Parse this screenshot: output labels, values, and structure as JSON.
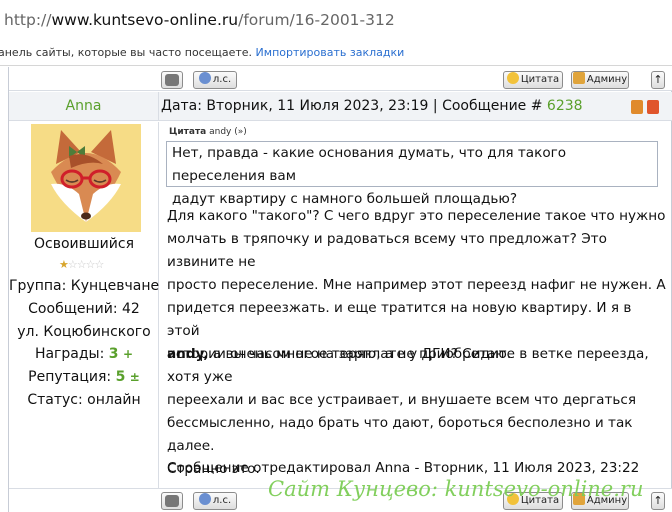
{
  "browser": {
    "url_prefix": "http://",
    "url_host": "www.kuntsevo-online.ru",
    "url_path": "/forum/16-2001-312"
  },
  "bookmarks_bar": {
    "text": "анель сайты, которые вы часто посещаете.",
    "import_link": "Импортировать закладки"
  },
  "toolbar": {
    "pm_label": "л.с.",
    "quote_label": "Цитата",
    "admin_label": "Админу",
    "up_label": "↑"
  },
  "post": {
    "author": "Anna",
    "date_text": "Дата: Вторник, 11 Июля 2023, 23:19 | Сообщение #",
    "number": "6238"
  },
  "profile": {
    "rank": "Освоившийся",
    "stars": "★",
    "stars_empty": "☆☆☆☆",
    "group": "Группа: Кунцевчане",
    "messages": "Сообщений: 42",
    "street": "ул. Коцюбинского",
    "awards_label": "Награды:",
    "awards_value": "3",
    "awards_plus": "+",
    "reputation_label": "Репутация:",
    "reputation_value": "5",
    "reputation_plus": "±",
    "status": "Статус: онлайн"
  },
  "quote": {
    "title": "Цитата",
    "author": "andy",
    "link": "(»)",
    "line1": "Нет, правда - какие основания думать, что для такого переселения вам",
    "line2": "дадут квартиру с намного большей площадью?"
  },
  "body": {
    "p1_l1": "Для какого \"такого\"? С чего вдруг это переселение такое что нужно",
    "p1_l2": "молчать в тряпочку и радоваться всему что предложат? Это извините не",
    "p1_l3": "просто переселение. Мне например этот переезд нафиг не нужен. А",
    "p1_l4": "придется переезжать. и еще тратится на новую квартиру. И я в этой",
    "p1_l5": "истории очень многое теряю, а не приобретаю.",
    "p2_name": "andy,",
    "p2_l1": " а вы часом не на зарплате у ДГИ? Сидите в ветке переезда,  хотя уже",
    "p2_l2": "переехали и вас все устраивает, и внушаете всем что дергаться",
    "p2_l3": "бессмысленно, надо брать что дают, бороться бесполезно и так далее.",
    "p2_l4": "Странно это.",
    "edited": "Сообщение отредактировал Anna - Вторник, 11 Июля 2023, 23:22"
  },
  "watermark": "Сайт Кунцево:  kuntsevo-online.ru",
  "colors": {
    "accent_green": "#5aa02c",
    "link_blue": "#2a6fd0",
    "row_bg": "#f1f3f6",
    "avatar_bg": "#f6dc86",
    "watermark": "#7ccd55"
  }
}
